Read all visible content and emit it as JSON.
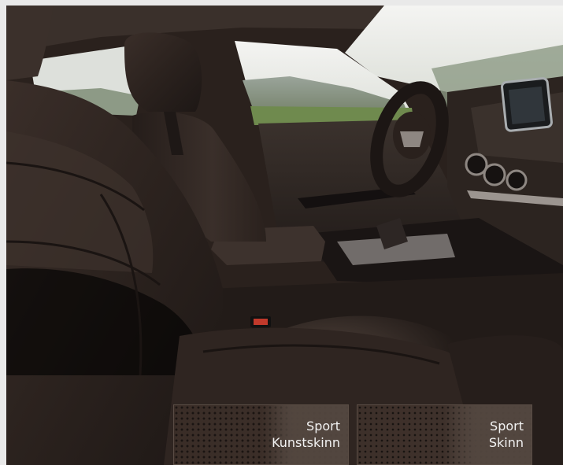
{
  "swatches": [
    {
      "line1": "Sport",
      "line2": "Kunstskinn"
    },
    {
      "line1": "Sport",
      "line2": "Skinn"
    }
  ],
  "colors": {
    "interior": "#2a211d",
    "leather": "#3b2e28",
    "label": "#f2f2f2",
    "accent_red": "#c0392b"
  }
}
